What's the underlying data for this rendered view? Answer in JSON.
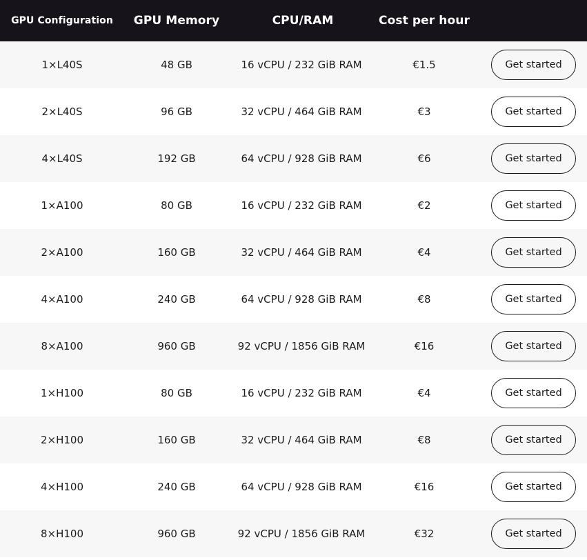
{
  "table": {
    "headers": {
      "gpu_configuration": "GPU Configuration",
      "gpu_memory": "GPU Memory",
      "cpu_ram": "CPU/RAM",
      "cost_per_hour": "Cost per hour"
    },
    "button_label": "Get started",
    "rows": [
      {
        "gpu": "1×L40S",
        "memory": "48 GB",
        "cpu_ram": "16 vCPU / 232 GiB RAM",
        "cost": "€1.5"
      },
      {
        "gpu": "2×L40S",
        "memory": "96 GB",
        "cpu_ram": "32 vCPU / 464 GiB RAM",
        "cost": "€3"
      },
      {
        "gpu": "4×L40S",
        "memory": "192 GB",
        "cpu_ram": "64 vCPU / 928 GiB RAM",
        "cost": "€6"
      },
      {
        "gpu": "1×A100",
        "memory": "80 GB",
        "cpu_ram": "16 vCPU / 232 GiB RAM",
        "cost": "€2"
      },
      {
        "gpu": "2×A100",
        "memory": "160 GB",
        "cpu_ram": "32 vCPU / 464 GiB RAM",
        "cost": "€4"
      },
      {
        "gpu": "4×A100",
        "memory": "240 GB",
        "cpu_ram": "64 vCPU / 928 GiB RAM",
        "cost": "€8"
      },
      {
        "gpu": "8×A100",
        "memory": "960 GB",
        "cpu_ram": "92 vCPU / 1856 GiB RAM",
        "cost": "€16"
      },
      {
        "gpu": "1×H100",
        "memory": "80 GB",
        "cpu_ram": "16 vCPU / 232 GiB RAM",
        "cost": "€4"
      },
      {
        "gpu": "2×H100",
        "memory": "160 GB",
        "cpu_ram": "32 vCPU / 464 GiB RAM",
        "cost": "€8"
      },
      {
        "gpu": "4×H100",
        "memory": "240 GB",
        "cpu_ram": "64 vCPU / 928 GiB RAM",
        "cost": "€16"
      },
      {
        "gpu": "8×H100",
        "memory": "960 GB",
        "cpu_ram": "92 vCPU / 1856 GiB RAM",
        "cost": "€32"
      }
    ]
  }
}
